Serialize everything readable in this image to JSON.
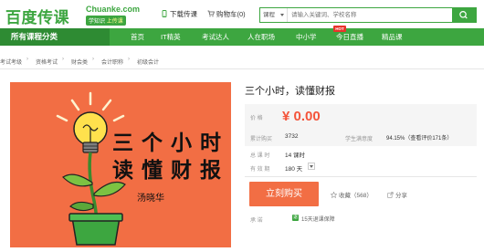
{
  "header": {
    "logo_cn": "百度传课",
    "logo_en": "Chuanke.com",
    "slogan_a": "学知识",
    "slogan_b": "上传课",
    "download_label": "下载传课",
    "cart_label": "购物车(0)",
    "search": {
      "category": "课程",
      "placeholder": "请输入关键词、学校名称"
    }
  },
  "nav": {
    "category_label": "所有课程分类",
    "items": [
      "首页",
      "IT精英",
      "考试达人",
      "人在职场",
      "中小学",
      "今日直播",
      "精品课"
    ],
    "hot_badge": "HOT"
  },
  "breadcrumb": [
    "考试考级",
    "资格考试",
    "财会类",
    "会计职称",
    "初级会计"
  ],
  "image": {
    "line1": "三个小时",
    "line2": "读懂财报",
    "author": "汤晓华"
  },
  "course": {
    "title": "三个小时，读懂财报",
    "price_label": "价    格",
    "price": "¥ 0.00",
    "purchases_label": "累计购买",
    "purchases": "3732",
    "satisfaction_label": "学生满意度",
    "satisfaction": "94.15%（查看评价171条）",
    "hours_label": "总 课 时",
    "hours": "14 课时",
    "validity_label": "有 效 期",
    "validity": "180 天",
    "service_label": "承    诺",
    "service_badge": "退",
    "service": "15天退课保障"
  },
  "actions": {
    "buy": "立刻购买",
    "favorite": "收藏（568）",
    "share": "分享"
  },
  "colors": {
    "brand_green": "#3da640",
    "accent_orange": "#f26e44",
    "price_red": "#f4543a"
  }
}
